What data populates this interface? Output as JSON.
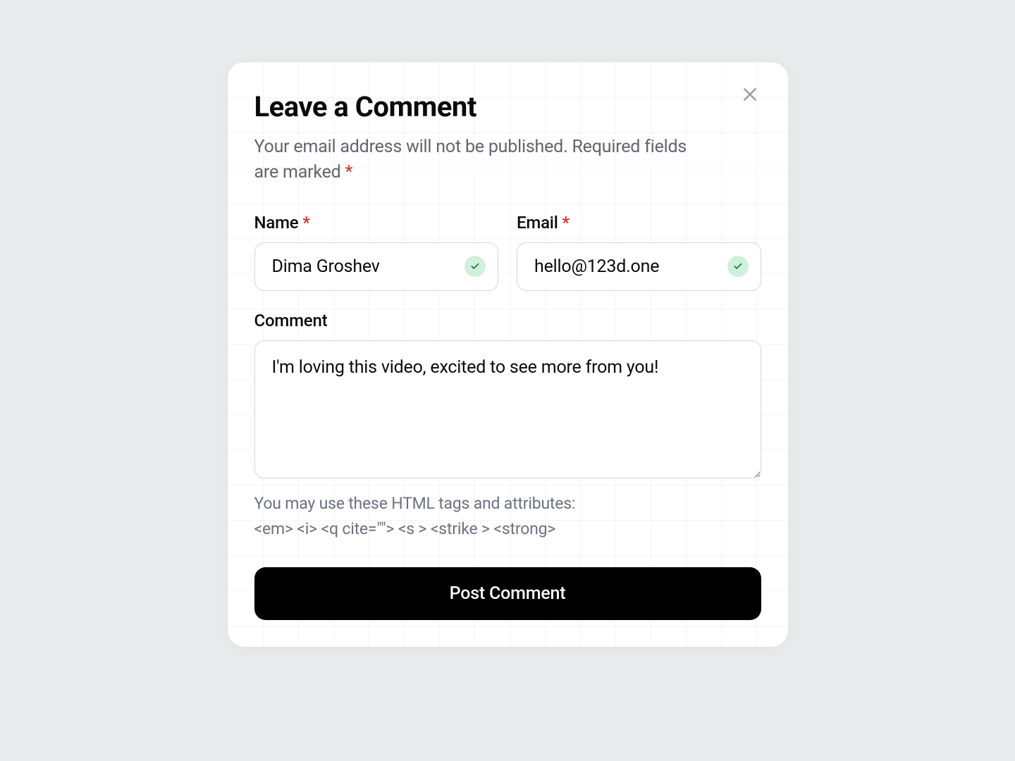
{
  "header": {
    "title": "Leave a Comment",
    "subtitle_prefix": "Your email address will not be published. Required fields are marked ",
    "required_marker": "*"
  },
  "fields": {
    "name": {
      "label": "Name",
      "required_marker": "*",
      "value": "Dima Groshev",
      "valid": true
    },
    "email": {
      "label": "Email",
      "required_marker": "*",
      "value": "hello@123d.one",
      "valid": true
    },
    "comment": {
      "label": "Comment",
      "value": "I'm loving this video, excited to see more from you!"
    }
  },
  "help": {
    "prefix": "You may use these HTML tags and attributes:",
    "tags": "<em> <i> <q cite=\"\"> <s > <strike > <strong>"
  },
  "actions": {
    "submit_label": "Post Comment"
  }
}
